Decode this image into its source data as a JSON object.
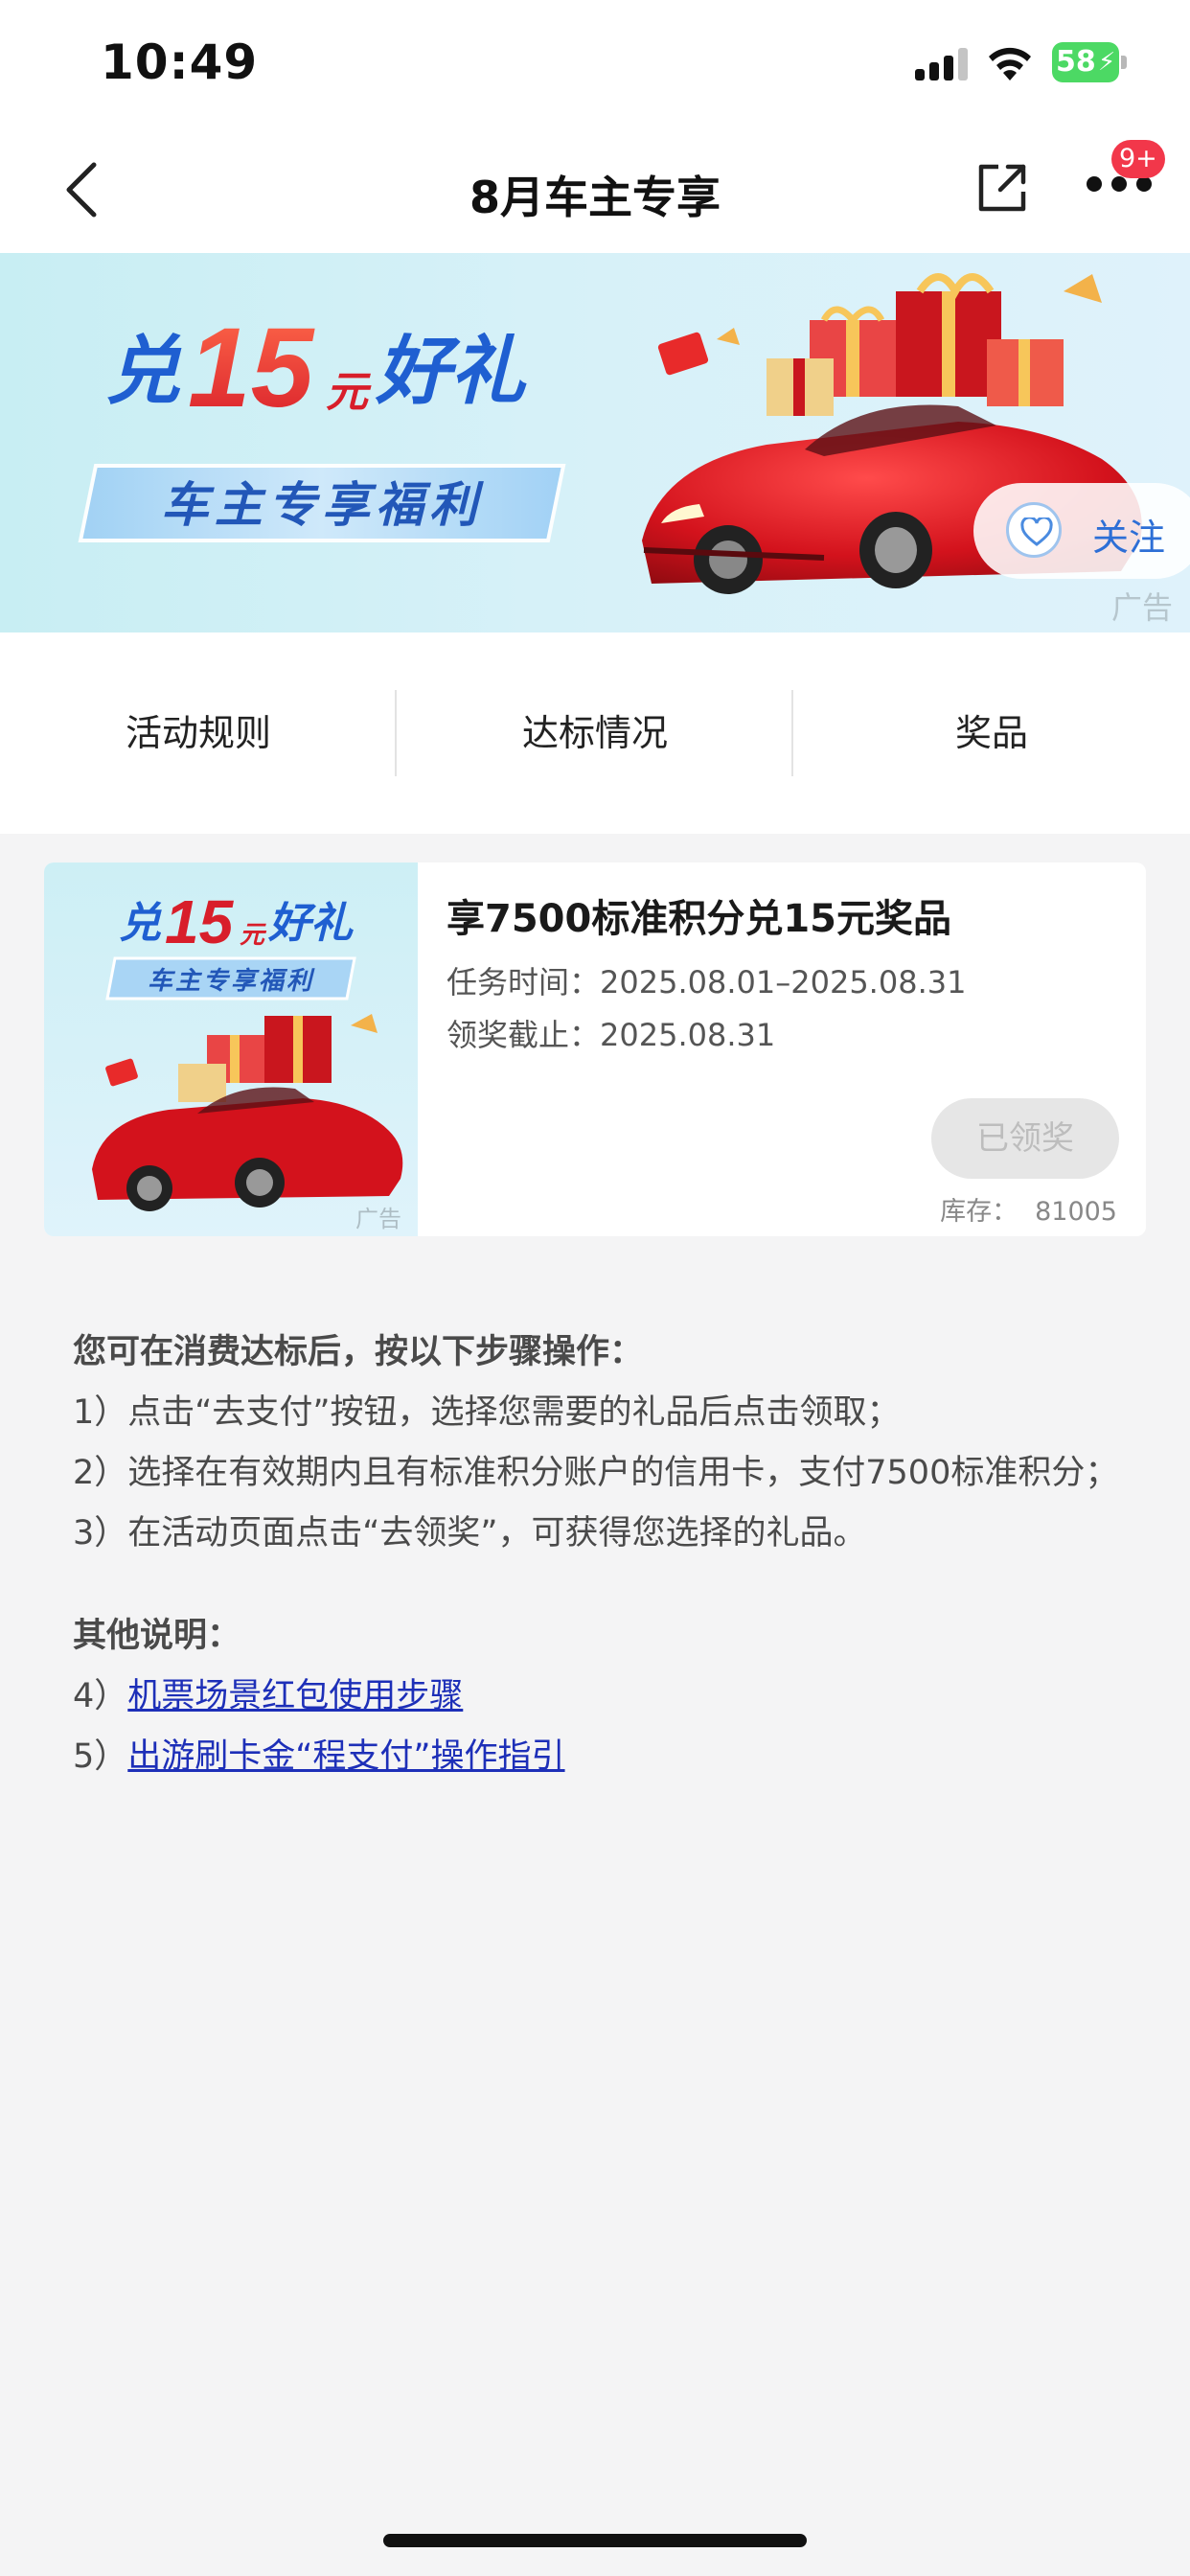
{
  "status_bar": {
    "time": "10:49",
    "battery": "58"
  },
  "nav": {
    "title": "8月车主专享",
    "badge": "9+"
  },
  "banner": {
    "headline_prefix": "兑",
    "headline_number": "15",
    "headline_unit": "元",
    "headline_suffix": "好礼",
    "subtitle": "车主专享福利",
    "follow_label": "关注",
    "ad_label": "广告"
  },
  "tabs": [
    {
      "label": "活动规则"
    },
    {
      "label": "达标情况"
    },
    {
      "label": "奖品"
    }
  ],
  "card": {
    "title": "享7500标准积分兑15元奖品",
    "task_time_label": "任务时间：",
    "task_time": "2025.08.01–2025.08.31",
    "deadline_label": "领奖截止：",
    "deadline": "2025.08.31",
    "button_label": "已领奖",
    "stock_label": "库存：",
    "stock_value": "81005",
    "thumb_headline_prefix": "兑",
    "thumb_headline_number": "15",
    "thumb_headline_unit": "元",
    "thumb_headline_suffix": "好礼",
    "thumb_subtitle": "车主专享福利",
    "ad_label": "广告"
  },
  "instructions": {
    "heading": "您可在消费达标后，按以下步骤操作：",
    "step1": "1）点击“去支付”按钮，选择您需要的礼品后点击领取；",
    "step2": "2）选择在有效期内且有标准积分账户的信用卡，支付7500标准积分；",
    "step3": "3）在活动页面点击“去领奖”，可获得您选择的礼品。",
    "other_heading": "其他说明：",
    "item4_prefix": "4）",
    "item4_link": "机票场景红包使用步骤",
    "item5_prefix": "5）",
    "item5_link": "出游刷卡金“程支付”操作指引"
  },
  "colors": {
    "accent_red": "#e8282e",
    "link_blue": "#1d2fb8",
    "follow_blue": "#2d6fd6",
    "badge_red": "#f2374a",
    "battery_green": "#4cd964"
  }
}
